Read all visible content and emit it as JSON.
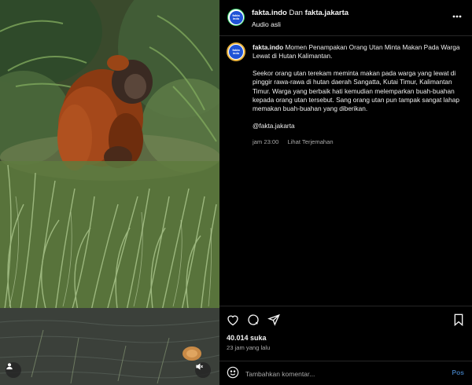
{
  "media": {
    "user_tag_icon": "user-icon",
    "sound_icon": "muted-speaker-icon"
  },
  "header": {
    "author": "fakta.indo",
    "connector": "Dan",
    "collaborator": "fakta.jakarta",
    "audio": "Audio asli",
    "more_icon": "more-horizontal-icon"
  },
  "avatar": {
    "lines": [
      "fakta",
      "indo"
    ],
    "brand_color": "#1e53d6"
  },
  "caption": {
    "author": "fakta.indo",
    "title": "Momen Penampakan Orang Utan Minta Makan Pada Warga Lewat di Hutan Kalimantan.",
    "body": "Seekor orang utan terekam meminta makan pada warga yang lewat di pinggir rawa-rawa di hutan daerah Sangatta, Kutai Timur, Kalimantan Timur. Warga yang berbaik hati kemudian melemparkan buah-buahan kepada orang utan tersebut. Sang orang utan pun tampak sangat lahap memakan buah-buahan yang diberikan.",
    "mention": "@fakta.jakarta",
    "time": "jam 23:00",
    "translate": "Lihat Terjemahan"
  },
  "actions": {
    "like_icon": "heart-icon",
    "comment_icon": "comment-icon",
    "share_icon": "send-icon",
    "save_icon": "bookmark-icon"
  },
  "likes": "40.014 suka",
  "posted_ago": "23 jam yang lalu",
  "comment": {
    "emoji_icon": "emoji-icon",
    "placeholder": "Tambahkan komentar...",
    "post_label": "Pos"
  }
}
